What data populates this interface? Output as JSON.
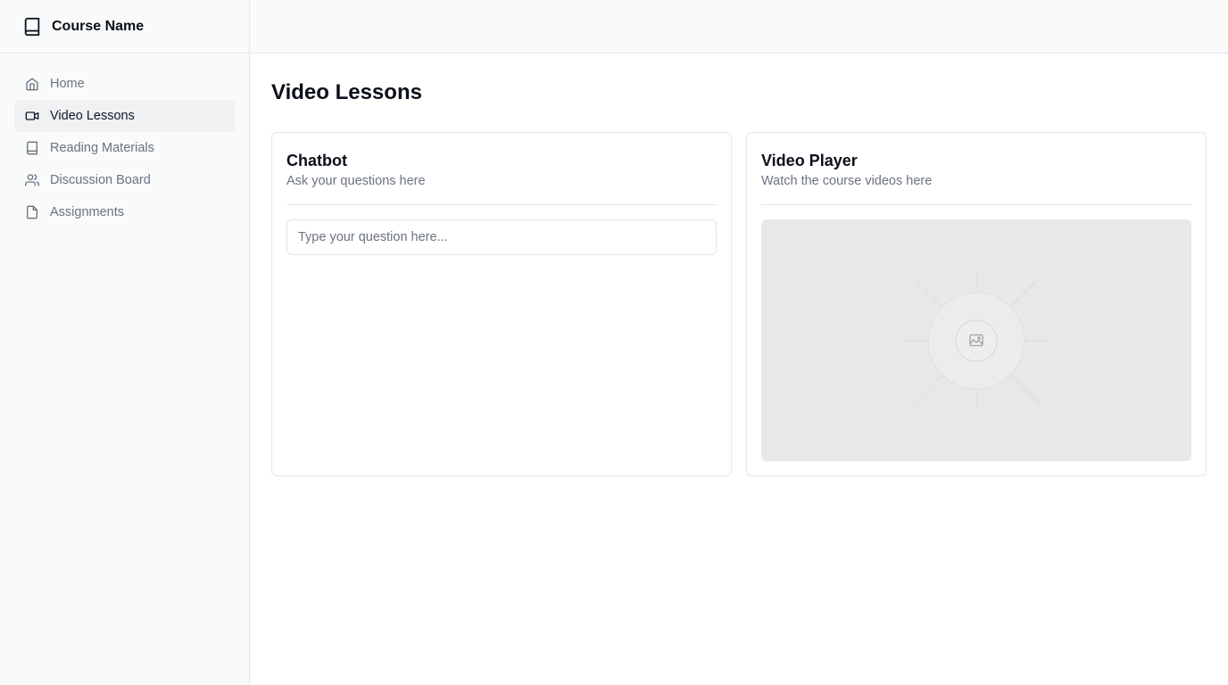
{
  "sidebar": {
    "brand": {
      "title": "Course Name",
      "icon": "book-icon"
    },
    "items": [
      {
        "label": "Home",
        "icon": "home-icon",
        "active": false
      },
      {
        "label": "Video Lessons",
        "icon": "video-icon",
        "active": true
      },
      {
        "label": "Reading Materials",
        "icon": "book-icon",
        "active": false
      },
      {
        "label": "Discussion Board",
        "icon": "users-icon",
        "active": false
      },
      {
        "label": "Assignments",
        "icon": "file-icon",
        "active": false
      }
    ]
  },
  "main": {
    "title": "Video Lessons",
    "chatbot": {
      "title": "Chatbot",
      "subtitle": "Ask your questions here",
      "input_placeholder": "Type your question here...",
      "input_value": ""
    },
    "video": {
      "title": "Video Player",
      "subtitle": "Watch the course videos here",
      "placeholder_icon": "image-icon"
    }
  },
  "colors": {
    "sidebar_bg": "#f9fafa",
    "active_item_bg": "#f0f1f3",
    "border": "#e5e7eb",
    "muted_text": "#6b7280",
    "video_placeholder_bg": "#e8e8e8"
  }
}
